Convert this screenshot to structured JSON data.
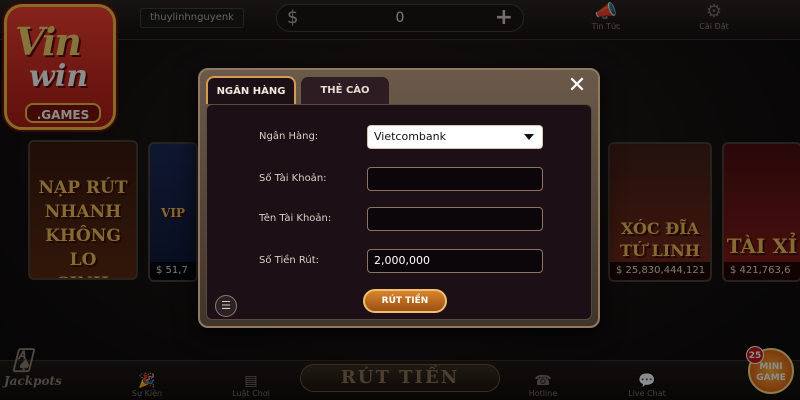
{
  "header": {
    "username": "thuylinhnguyenk",
    "balance_symbol": "$",
    "balance": "0",
    "add_symbol": "+",
    "news_label": "Tin Tức",
    "settings_label": "Cài Đặt"
  },
  "logo": {
    "line1": "Vin",
    "line2": "win",
    "sub": ".GAMES"
  },
  "cards": [
    {
      "title": "NẠP RÚT\nNHANH\nKHÔNG LO\nSINH TRẮC"
    },
    {
      "title": "VIP",
      "jackpot": "$ 51,7"
    },
    {
      "title": "XÓC ĐĨA\nTỨ LINH",
      "jackpot": "$ 25,830,444,121"
    },
    {
      "title": "TÀI XỈ",
      "jackpot": "$ 421,763,6"
    }
  ],
  "dialog": {
    "tab_active": "NGÂN HÀNG",
    "tab_inactive": "THẺ CÀO",
    "close_glyph": "✕",
    "fields": {
      "bank_label": "Ngân Hàng:",
      "bank_value": "Vietcombank",
      "account_no_label": "Số Tài Khoản:",
      "account_no_value": "",
      "account_name_label": "Tên Tài Khoản:",
      "account_name_value": "",
      "amount_label": "Số Tiền Rút:",
      "amount_value": "2,000,000"
    },
    "submit_label": "RÚT TIỀN",
    "history_glyph": "☰"
  },
  "footer": {
    "jackpots_label": "Jackpots",
    "events_label": "Sự Kiện",
    "rules_label": "Luật Chơi",
    "page_title": "RÚT TIỀN",
    "hotline_label": "Hotline",
    "livechat_label": "Live Chat",
    "minigame_count": "25",
    "minigame_label": "MINI GAME"
  },
  "colors": {
    "accent_gold": "#d39a54",
    "dialog_bg": "#1d0f16",
    "button_orange": "#c8762a"
  }
}
